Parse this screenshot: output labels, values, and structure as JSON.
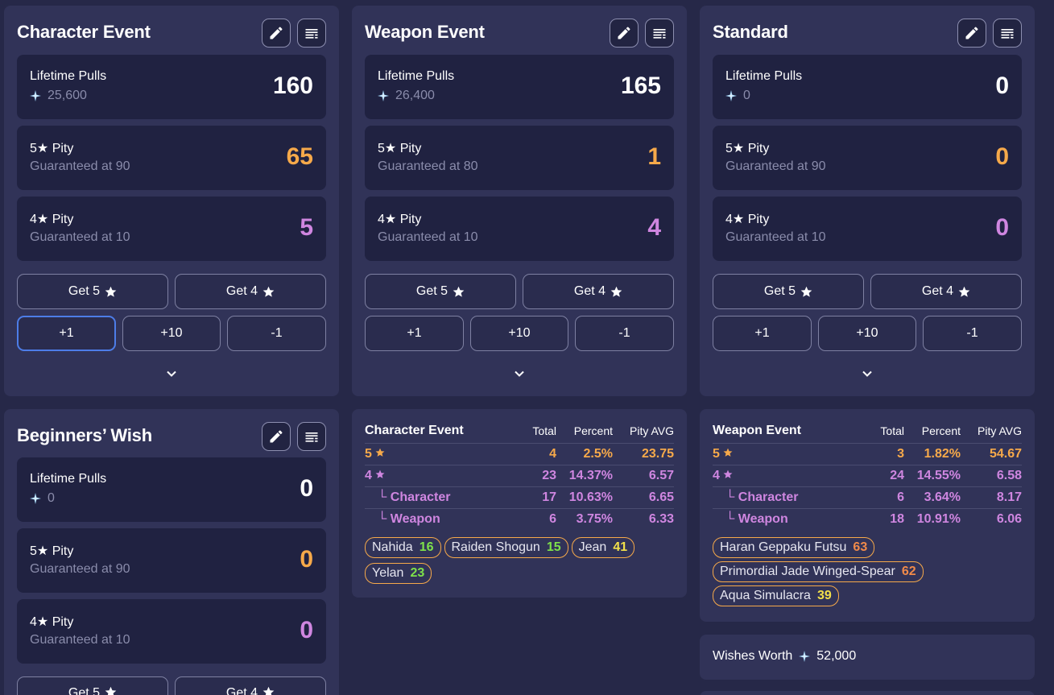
{
  "colors": {
    "background": "#262848",
    "panel": "#313358",
    "box": "#202241",
    "five_star": "#f6a94a",
    "four_star": "#cf86e0",
    "focus": "#4d7de8",
    "pity_low": "#7ee14a",
    "pity_mid": "#f2e04a",
    "pity_high": "#f08a4a"
  },
  "icons": {
    "edit": "pencil-icon",
    "menu": "list-icon",
    "currency": "primogem-sparkle-icon",
    "expand": "chevron-down-icon",
    "star": "star-icon"
  },
  "banners": [
    {
      "title": "Character Event",
      "lifetime_label": "Lifetime Pulls",
      "lifetime_cost": "25,600",
      "lifetime_value": "160",
      "five_label": "5★ Pity",
      "five_guarantee": "Guaranteed at 90",
      "five_value": "65",
      "four_label": "4★ Pity",
      "four_guarantee": "Guaranteed at 10",
      "four_value": "5",
      "get5": "Get 5",
      "get4": "Get 4",
      "plus1": "+1",
      "plus10": "+10",
      "minus1": "-1"
    },
    {
      "title": "Weapon Event",
      "lifetime_label": "Lifetime Pulls",
      "lifetime_cost": "26,400",
      "lifetime_value": "165",
      "five_label": "5★ Pity",
      "five_guarantee": "Guaranteed at 80",
      "five_value": "1",
      "four_label": "4★ Pity",
      "four_guarantee": "Guaranteed at 10",
      "four_value": "4",
      "get5": "Get 5",
      "get4": "Get 4",
      "plus1": "+1",
      "plus10": "+10",
      "minus1": "-1"
    },
    {
      "title": "Standard",
      "lifetime_label": "Lifetime Pulls",
      "lifetime_cost": "0",
      "lifetime_value": "0",
      "five_label": "5★ Pity",
      "five_guarantee": "Guaranteed at 90",
      "five_value": "0",
      "four_label": "4★ Pity",
      "four_guarantee": "Guaranteed at 10",
      "four_value": "0",
      "get5": "Get 5",
      "get4": "Get 4",
      "plus1": "+1",
      "plus10": "+10",
      "minus1": "-1"
    },
    {
      "title": "Beginners’ Wish",
      "lifetime_label": "Lifetime Pulls",
      "lifetime_cost": "0",
      "lifetime_value": "0",
      "five_label": "5★ Pity",
      "five_guarantee": "Guaranteed at 90",
      "five_value": "0",
      "four_label": "4★ Pity",
      "four_guarantee": "Guaranteed at 10",
      "four_value": "0",
      "get5": "Get 5",
      "get4": "Get 4"
    }
  ],
  "stats": [
    {
      "title": "Character Event",
      "headers": [
        "Total",
        "Percent",
        "Pity AVG"
      ],
      "rows": [
        {
          "label": "5",
          "total": "4",
          "percent": "2.5%",
          "avg": "23.75"
        },
        {
          "label": "4",
          "total": "23",
          "percent": "14.37%",
          "avg": "6.57"
        },
        {
          "label": "└ Character",
          "total": "17",
          "percent": "10.63%",
          "avg": "6.65"
        },
        {
          "label": "└ Weapon",
          "total": "6",
          "percent": "3.75%",
          "avg": "6.33"
        }
      ],
      "chips": [
        {
          "name": "Nahida",
          "count": "16",
          "tone": "low"
        },
        {
          "name": "Raiden Shogun",
          "count": "15",
          "tone": "low"
        },
        {
          "name": "Jean",
          "count": "41",
          "tone": "mid"
        },
        {
          "name": "Yelan",
          "count": "23",
          "tone": "low"
        }
      ]
    },
    {
      "title": "Weapon Event",
      "headers": [
        "Total",
        "Percent",
        "Pity AVG"
      ],
      "rows": [
        {
          "label": "5",
          "total": "3",
          "percent": "1.82%",
          "avg": "54.67"
        },
        {
          "label": "4",
          "total": "24",
          "percent": "14.55%",
          "avg": "6.58"
        },
        {
          "label": "└ Character",
          "total": "6",
          "percent": "3.64%",
          "avg": "8.17"
        },
        {
          "label": "└ Weapon",
          "total": "18",
          "percent": "10.91%",
          "avg": "6.06"
        }
      ],
      "chips": [
        {
          "name": "Haran Geppaku Futsu",
          "count": "63",
          "tone": "high"
        },
        {
          "name": "Primordial Jade Winged-Spear",
          "count": "62",
          "tone": "high"
        },
        {
          "name": "Aqua Simulacra",
          "count": "39",
          "tone": "mid"
        }
      ]
    }
  ],
  "worth": {
    "label": "Wishes Worth",
    "value": "52,000"
  }
}
